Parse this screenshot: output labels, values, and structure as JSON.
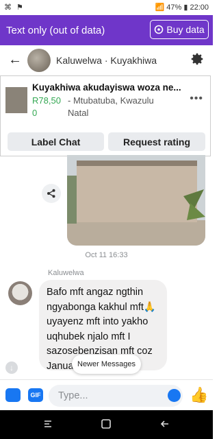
{
  "status": {
    "left_icons": "⌘ ⚑",
    "right": "📶 47% ▮ 22:00"
  },
  "banner": {
    "text": "Text only (out of data)",
    "buy_label": "Buy data"
  },
  "header": {
    "contact": "Kaluwelwa · Kuyakhiwa"
  },
  "listing": {
    "title": "Kuyakhiwa akudayiswa woza ne...",
    "price_line1": "R78,50",
    "price_line2": "0",
    "location_line1": "- Mtubatuba, Kwazulu",
    "location_line2": "Natal",
    "more": "•••",
    "label_chat": "Label Chat",
    "request_rating": "Request rating"
  },
  "conversation": {
    "timestamp": "Oct 11 16:33",
    "sender": "Kaluwelwa",
    "message": "Bafo mft angaz ngthin ngyabonga kakhul mft🙏 uyayenz mft into yakho uqhubek njalo mft I sazosebenzisan mft coz Janua         uma",
    "newer_messages": "Newer Messages"
  },
  "composer": {
    "placeholder": "Type...",
    "gif_label": "GIF"
  },
  "colors": {
    "banner": "#6f36c9",
    "accent": "#1877f2",
    "price": "#34a853"
  }
}
